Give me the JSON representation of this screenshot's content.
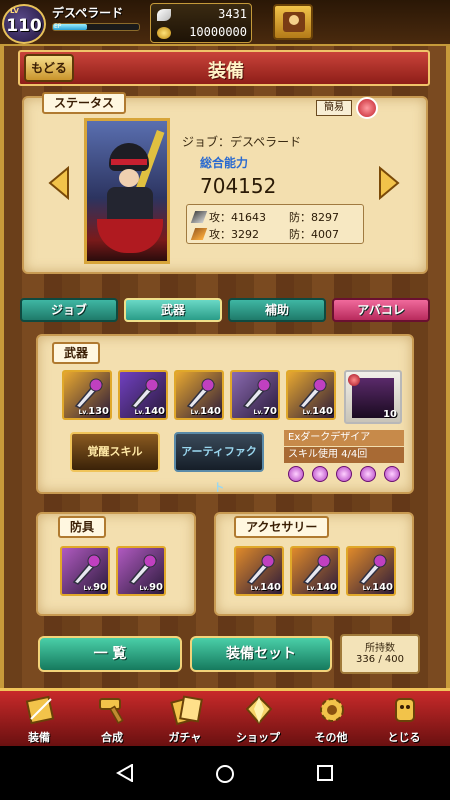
{
  "top_bar": {
    "level_tag": "LV",
    "level": "110",
    "player_name": "デスペラード",
    "exp_label": "EP",
    "feathers": "3431",
    "coins": "10000000",
    "exp_fraction": 0.4
  },
  "header": {
    "back_label": "もどる",
    "title": "装備"
  },
  "status": {
    "section_label": "ステータス",
    "simple_label": "簡易",
    "job_label": "ジョブ：デスペラード",
    "power_label": "総合能力",
    "power_value": "704152",
    "phys_attack": "攻：41643",
    "phys_defense": "防：8297",
    "mag_attack": "攻：3292",
    "mag_defense": "防：4007"
  },
  "tabs": [
    {
      "label": "ジョブ"
    },
    {
      "label": "武器"
    },
    {
      "label": "補助"
    },
    {
      "label": "アバコレ"
    }
  ],
  "weapons": {
    "section_label": "武器",
    "items": [
      {
        "lv": "130",
        "color": "#e8a830",
        "icon": "lance-icon"
      },
      {
        "lv": "140",
        "color": "#7040c0",
        "icon": "scythe-icon"
      },
      {
        "lv": "140",
        "color": "#e8a830",
        "icon": "axe-icon"
      },
      {
        "lv": "70",
        "color": "#8a6ab0",
        "icon": "bow-icon"
      },
      {
        "lv": "140",
        "color": "#e8a830",
        "icon": "sword-icon"
      }
    ],
    "awaken_label": "覚醒スキル",
    "artifact_label": "アーティファクト",
    "ex_lv": "10",
    "ex_name": "Exダークデザイア",
    "ex_skill": "スキル使用 4/4回"
  },
  "armor": {
    "section_label": "防具",
    "items": [
      {
        "lv": "90"
      },
      {
        "lv": "90"
      }
    ]
  },
  "accessory": {
    "section_label": "アクセサリー",
    "items": [
      {
        "lv": "140"
      },
      {
        "lv": "140"
      },
      {
        "lv": "140"
      }
    ]
  },
  "actions": {
    "list_label": "一 覧",
    "set_label": "装備セット",
    "count_title": "所持数",
    "count_value": "336 / 400"
  },
  "bottom_nav": [
    {
      "label": "装備",
      "icon": "equip-icon"
    },
    {
      "label": "合成",
      "icon": "hammer-icon"
    },
    {
      "label": "ガチャ",
      "icon": "gacha-icon"
    },
    {
      "label": "ショップ",
      "icon": "shop-crystal-icon"
    },
    {
      "label": "その他",
      "icon": "gear-icon"
    },
    {
      "label": "とじる",
      "icon": "close-icon"
    }
  ]
}
